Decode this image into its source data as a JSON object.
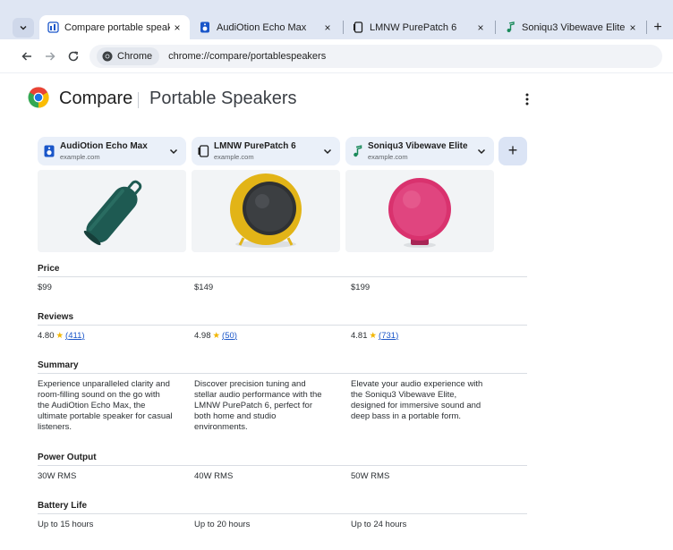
{
  "browser": {
    "tabs": [
      {
        "title": "Compare portable speake",
        "active": true
      },
      {
        "title": "AudiOtion Echo Max",
        "active": false
      },
      {
        "title": "LMNW PurePatch 6",
        "active": false
      },
      {
        "title": "Soniqu3 Vibewave Elite",
        "active": false
      }
    ],
    "close_glyph": "×",
    "new_tab_glyph": "+",
    "chip_label": "Chrome",
    "url": "chrome://compare/portablespeakers"
  },
  "page": {
    "brand": "Compare",
    "title": "Portable Speakers",
    "add_glyph": "+"
  },
  "products": [
    {
      "name": "AudiOtion Echo Max",
      "site": "example.com",
      "price": "$99",
      "rating": "4.80",
      "reviews": "411",
      "summary": "Experience unparalleled clarity and room-filling sound on the go with the AudiOtion Echo Max, the ultimate portable speaker for casual listeners.",
      "power": "30W RMS",
      "battery": "Up to 15 hours"
    },
    {
      "name": "LMNW PurePatch 6",
      "site": "example.com",
      "price": "$149",
      "rating": "4.98",
      "reviews": "50",
      "summary": "Discover precision tuning and stellar audio performance with the LMNW PurePatch 6, perfect for both home and studio environments.",
      "power": "40W RMS",
      "battery": "Up to 20 hours"
    },
    {
      "name": "Soniqu3 Vibewave Elite",
      "site": "example.com",
      "price": "$199",
      "rating": "4.81",
      "reviews": "731",
      "summary": "Elevate your audio experience with the Soniqu3 Vibewave Elite, designed for immersive sound and deep bass in a portable form.",
      "power": "50W RMS",
      "battery": "Up to 24 hours"
    }
  ],
  "sections": {
    "price": "Price",
    "reviews": "Reviews",
    "summary": "Summary",
    "power": "Power Output",
    "battery": "Battery Life"
  },
  "review_format": {
    "star": "★",
    "open": "(",
    "close": ")"
  },
  "icons": {
    "tab_menu": "chevron-down-icon",
    "compare_tab": "compare-icon",
    "back": "arrow-left-icon",
    "forward": "arrow-right-icon",
    "reload": "reload-icon",
    "chrome": "chrome-icon",
    "more": "more-vert-icon",
    "product_1": "speaker-icon",
    "product_2": "speaker-icon",
    "product_3": "music-note-icon"
  },
  "colors": {
    "tabstrip": "#dfe6f3",
    "product_header": "#eaf0f9",
    "add_button": "#dbe4f5",
    "link": "#1a56c9",
    "star": "#f2b600",
    "speaker_1": "#1e5a52",
    "speaker_2": "#e2b417",
    "speaker_3": "#d9326e"
  }
}
